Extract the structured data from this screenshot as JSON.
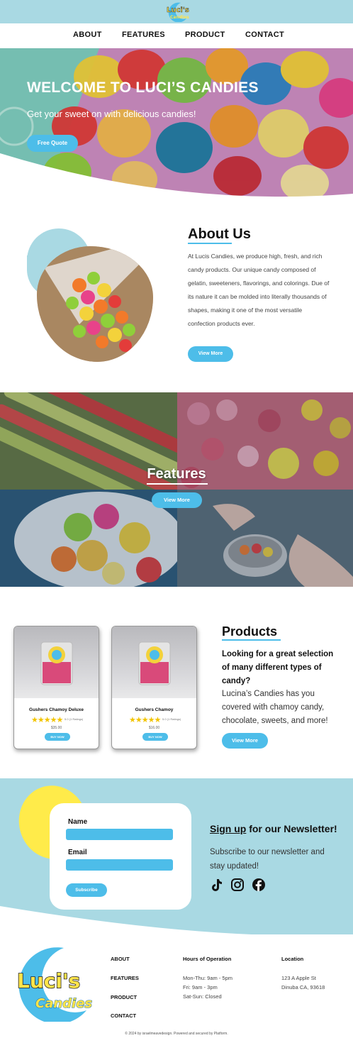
{
  "brand": {
    "logo_text": "Luci's Candies",
    "logo_word_top": "Luci's",
    "logo_word_bottom": "Candies",
    "colors": {
      "primary": "#4dbde9",
      "banner": "#a9d9e3",
      "accent_yellow": "#ffeb4a"
    }
  },
  "nav": {
    "items": [
      {
        "label": "ABOUT"
      },
      {
        "label": "FEATURES"
      },
      {
        "label": "PRODUCT"
      },
      {
        "label": "CONTACT"
      }
    ]
  },
  "hero": {
    "title": "WELCOME TO LUCI’S CANDIES",
    "subtitle": "Get your sweet on with delicious candies!",
    "button": "Free Quote"
  },
  "about": {
    "heading": "About Us",
    "body": "At Lucis Candies, we produce high, fresh, and rich candy products. Our unique candy composed of gelatin, sweeteners, flavorings, and colorings. Due of its nature it can be molded into literally thousands of shapes, making it one of the most versatile confection products ever.",
    "button": "View More"
  },
  "features": {
    "heading": "Features",
    "button": "View More"
  },
  "products": {
    "heading": "Products",
    "lead": "Looking for a great selection of many different types of candy?",
    "body": "Lucina’s Candies has you covered with chamoy candy, chocolate, sweets, and more!",
    "button": "View More",
    "cards": [
      {
        "name": "Gushers Chamoy Deluxe",
        "stars": "★★★★★",
        "ratings": "5.0 (1 Ratings)",
        "price": "$35.00",
        "button": "BUY NOW",
        "rating_value": 5
      },
      {
        "name": "Gushers Chamoy",
        "stars": "★★★★★",
        "ratings": "5.0 (1 Ratings)",
        "price": "$16.00",
        "button": "BUY NOW",
        "rating_value": 5
      }
    ]
  },
  "newsletter": {
    "name_label": "Name",
    "email_label": "Email",
    "submit": "Subscribe",
    "heading_underlined": "Sign up",
    "heading_rest": " for our Newsletter!",
    "body": "Subscribe to our newsletter and stay updated!",
    "social_icons": [
      "tiktok-icon",
      "instagram-icon",
      "facebook-icon"
    ]
  },
  "footer": {
    "links": [
      {
        "label": "ABOUT"
      },
      {
        "label": "FEATURES"
      },
      {
        "label": "PRODUCT"
      },
      {
        "label": "CONTACT"
      }
    ],
    "hours_heading": "Hours of Operation",
    "hours": [
      "Mon-Thu: 9am - 5pm",
      "Fri: 9am - 3pm",
      "Sat-Sun: Closed"
    ],
    "location_heading": "Location",
    "location": [
      "123 A Apple St",
      "Dinuba CA, 93618"
    ],
    "copyright": "© 2024 by israelmeavedesign. Powered and secured by Platform."
  }
}
